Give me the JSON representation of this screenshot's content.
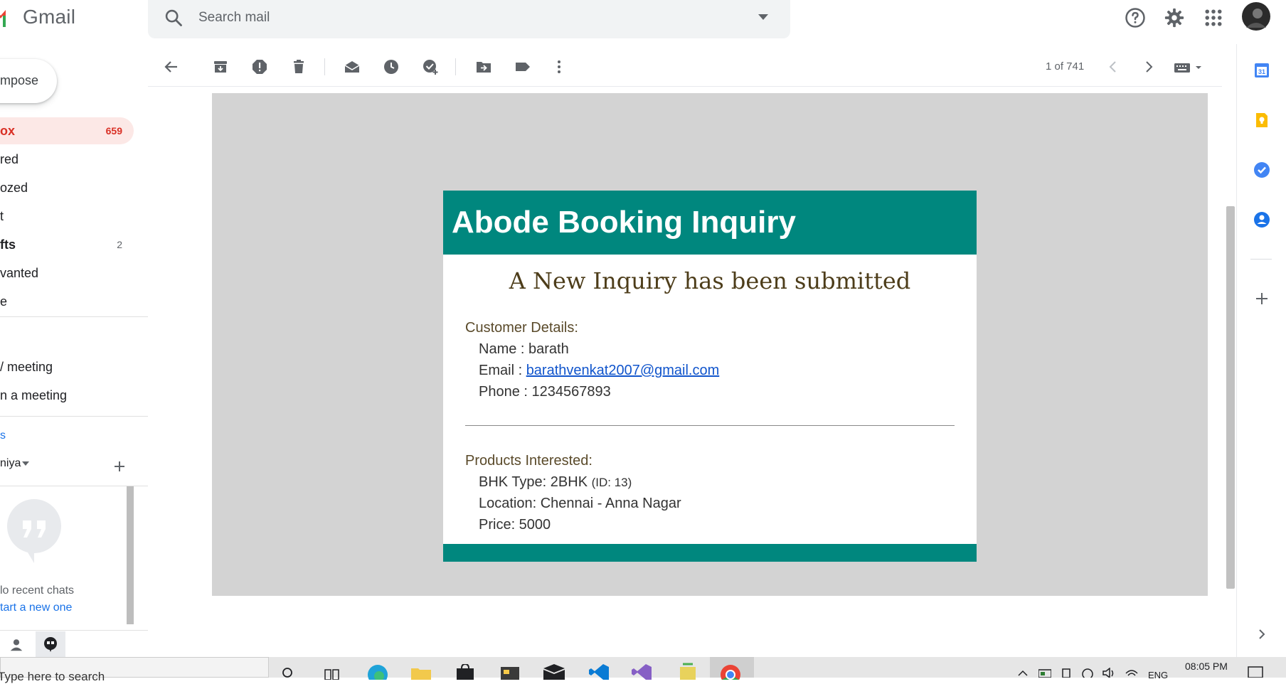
{
  "header": {
    "app_name": "Gmail",
    "search_placeholder": "Search mail"
  },
  "sidebar": {
    "compose_label": "mpose",
    "items": [
      {
        "label": "ox",
        "count": "659",
        "active": true
      },
      {
        "label": "red",
        "count": ""
      },
      {
        "label": "ozed",
        "count": ""
      },
      {
        "label": "t",
        "count": ""
      },
      {
        "label": "fts",
        "count": "2"
      },
      {
        "label": "vanted",
        "count": ""
      },
      {
        "label": "e",
        "count": ""
      }
    ],
    "meet": {
      "new_meeting": "/ meeting",
      "join_meeting": "n a meeting"
    },
    "hangouts": {
      "section_label": "s",
      "user": "niya",
      "no_recent": "lo recent chats",
      "start_new": "tart a new one"
    }
  },
  "toolbar": {
    "pagination": "1 of 741"
  },
  "email": {
    "header_title": "Abode Booking Inquiry",
    "subtitle": "A New Inquiry has been submitted",
    "customer_section": "Customer Details:",
    "name_line": "Name : barath",
    "email_label": "Email  : ",
    "email_value": "barathvenkat2007@gmail.com",
    "phone_line": "Phone : 1234567893",
    "products_section": "Products Interested:",
    "bhk_line": "BHK Type: 2BHK ",
    "bhk_id": "(ID: 13)",
    "location_line": "Location: Chennai - Anna Nagar",
    "price_line": "Price: 5000"
  },
  "taskbar": {
    "search_placeholder": "Type here to search",
    "lang": "ENG",
    "time": "08:05 PM"
  },
  "colors": {
    "teal": "#00877e",
    "inbox_red": "#d93025",
    "link_blue": "#1155cc"
  },
  "icons": {
    "top": [
      "search-icon",
      "chevron-down-icon",
      "help-icon",
      "gear-icon",
      "apps-grid-icon",
      "avatar"
    ],
    "toolbar": [
      "back-icon",
      "archive-icon",
      "spam-icon",
      "delete-icon",
      "mark-unread-icon",
      "snooze-icon",
      "add-task-icon",
      "move-to-icon",
      "label-icon",
      "more-vert-icon",
      "prev-icon",
      "next-icon",
      "keyboard-icon"
    ],
    "rail": [
      "calendar-icon",
      "keep-icon",
      "tasks-icon",
      "contacts-icon",
      "add-icon",
      "expand-icon"
    ]
  }
}
